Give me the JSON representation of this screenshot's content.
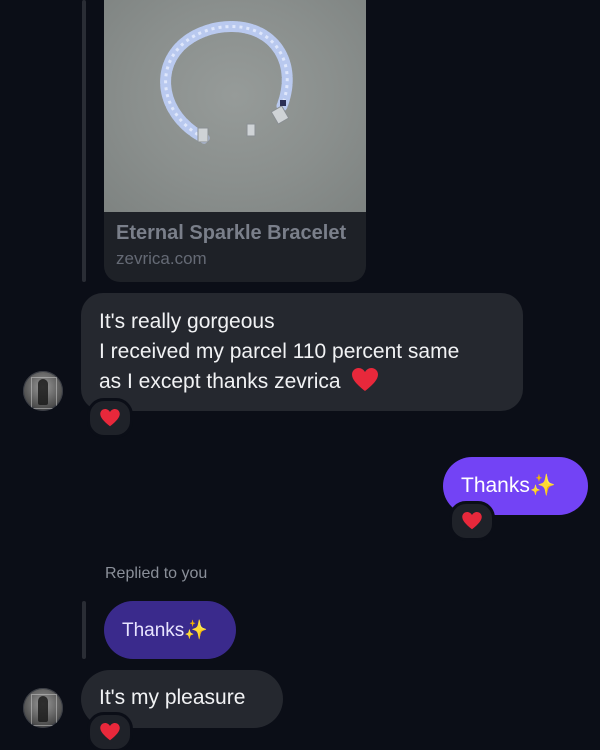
{
  "link_preview": {
    "title": "Eternal Sparkle Bracelet",
    "domain": "zevrica.com"
  },
  "messages": [
    {
      "id": "incoming-1",
      "lines": [
        "It's really gorgeous",
        "I received my parcel 110 percent same",
        "as  I except thanks zevrica"
      ],
      "trailing_emoji": "❤️",
      "reaction": "heart"
    },
    {
      "id": "outgoing-1",
      "text": "Thanks",
      "trailing_emoji": "✨",
      "reaction": "heart"
    },
    {
      "id": "incoming-2",
      "reply_label": "Replied to you",
      "quoted_text": "Thanks",
      "quoted_emoji": "✨",
      "text": "It's my pleasure",
      "reaction": "heart"
    }
  ],
  "colors": {
    "background": "#0b0e17",
    "incoming_bubble": "#25282f",
    "outgoing_bubble": "#7343f5",
    "quoted_bubble": "#3a2a8c",
    "heart": "#e8283b"
  }
}
